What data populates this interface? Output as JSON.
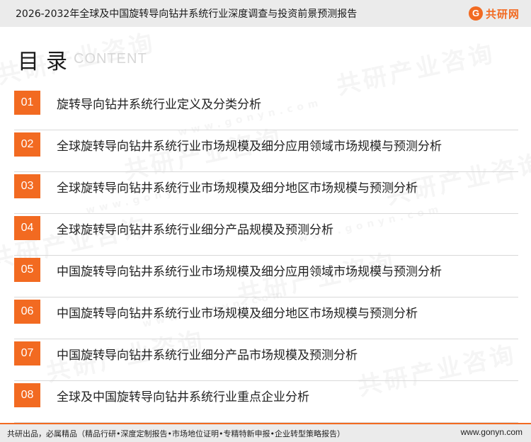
{
  "header": {
    "title": "2026-2032年全球及中国旋转导向钻井系统行业深度调查与投资前景预测报告",
    "logo_mark": "G",
    "logo_text": "共研网"
  },
  "toc": {
    "title": "目录",
    "subtitle": "CONTENT",
    "items": [
      {
        "num": "01",
        "label": "旋转导向钻井系统行业定义及分类分析"
      },
      {
        "num": "02",
        "label": "全球旋转导向钻井系统行业市场规模及细分应用领域市场规模与预测分析"
      },
      {
        "num": "03",
        "label": "全球旋转导向钻井系统行业市场规模及细分地区市场规模与预测分析"
      },
      {
        "num": "04",
        "label": "全球旋转导向钻井系统行业细分产品规模及预测分析"
      },
      {
        "num": "05",
        "label": "中国旋转导向钻井系统行业市场规模及细分应用领域市场规模与预测分析"
      },
      {
        "num": "06",
        "label": "中国旋转导向钻井系统行业市场规模及细分地区市场规模与预测分析"
      },
      {
        "num": "07",
        "label": "中国旋转导向钻井系统行业细分产品市场规模及预测分析"
      },
      {
        "num": "08",
        "label": "全球及中国旋转导向钻井系统行业重点企业分析"
      }
    ]
  },
  "footer": {
    "left": "共研出品，必属精品（精品行研•深度定制报告•市场地位证明•专精特新申报•企业转型策略报告）",
    "right": "www.gonyn.com"
  },
  "watermark": {
    "text": "共研产业咨询",
    "url": "www.gonyn.com"
  },
  "colors": {
    "accent": "#f26a21",
    "bar_bg": "#ebebeb",
    "divider": "#d9d9d9"
  }
}
